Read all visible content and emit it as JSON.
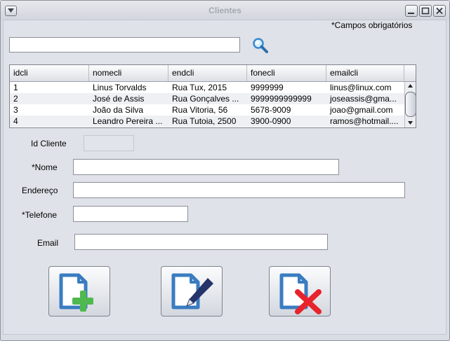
{
  "window": {
    "title": "Clientes"
  },
  "required_note": "*Campos obrigatórios",
  "search": {
    "value": "",
    "placeholder": ""
  },
  "table": {
    "columns": [
      "idcli",
      "nomecli",
      "endcli",
      "fonecli",
      "emailcli"
    ],
    "rows": [
      [
        "1",
        "Linus Torvalds",
        "Rua Tux, 2015",
        "9999999",
        "linus@linux.com"
      ],
      [
        "2",
        "José de Assis",
        "Rua Gonçalves ...",
        "9999999999999",
        "joseassis@gma..."
      ],
      [
        "3",
        "João da Silva",
        "Rua Vitoria, 56",
        "5678-9009",
        "joao@gmail.com"
      ],
      [
        "4",
        "Leandro Pereira ...",
        "Rua Tutoia, 2500",
        "3900-0900",
        "ramos@hotmail...."
      ]
    ]
  },
  "form": {
    "id_label": "Id Cliente",
    "name_label": "*Nome",
    "address_label": "Endereço",
    "phone_label": "*Telefone",
    "email_label": "Email",
    "id_value": "",
    "name_value": "",
    "address_value": "",
    "phone_value": "",
    "email_value": ""
  },
  "icons": {
    "add": "add-document-icon",
    "edit": "edit-document-icon",
    "delete": "delete-document-icon",
    "search": "search-icon"
  },
  "colors": {
    "doc_blue": "#3a7cc1",
    "add_green": "#4fb94f",
    "delete_red": "#e8232b",
    "pen_navy": "#25356b"
  }
}
